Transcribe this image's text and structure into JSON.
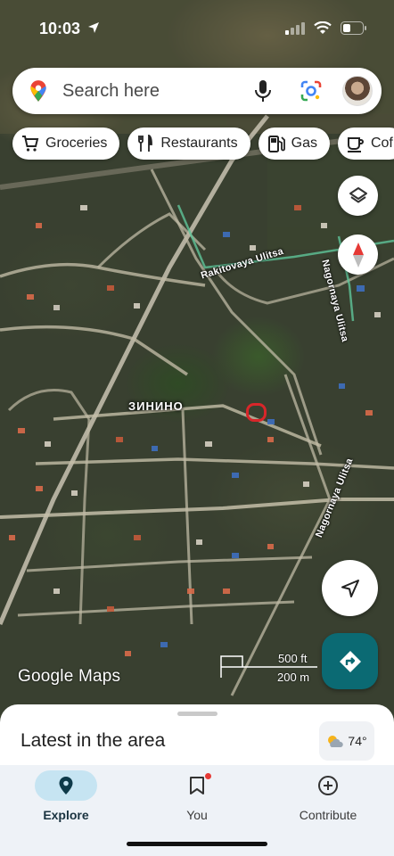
{
  "status_bar": {
    "time": "10:03"
  },
  "search": {
    "placeholder": "Search here"
  },
  "chips": [
    {
      "label": "Groceries",
      "icon": "cart-icon"
    },
    {
      "label": "Restaurants",
      "icon": "fork-knife-icon"
    },
    {
      "label": "Gas",
      "icon": "gas-pump-icon"
    },
    {
      "label": "Cof",
      "icon": "coffee-cup-icon"
    }
  ],
  "map": {
    "village": "ЗИНИНО",
    "streets": {
      "rakitovaya": "Rakitovaya Ulitsa",
      "nagornaya_top": "Nagornaya Ulitsa",
      "nagornaya_bottom": "Nagornaya Ulitsa"
    },
    "watermark": "Google Maps",
    "scale_ft": "500 ft",
    "scale_m": "200 m"
  },
  "sheet": {
    "title": "Latest in the area",
    "temperature": "74°"
  },
  "nav": {
    "explore": "Explore",
    "you": "You",
    "contribute": "Contribute"
  },
  "colors": {
    "accent": "#0b6a73",
    "active_tab": "#c6e4f2",
    "marker": "#d8262a"
  }
}
